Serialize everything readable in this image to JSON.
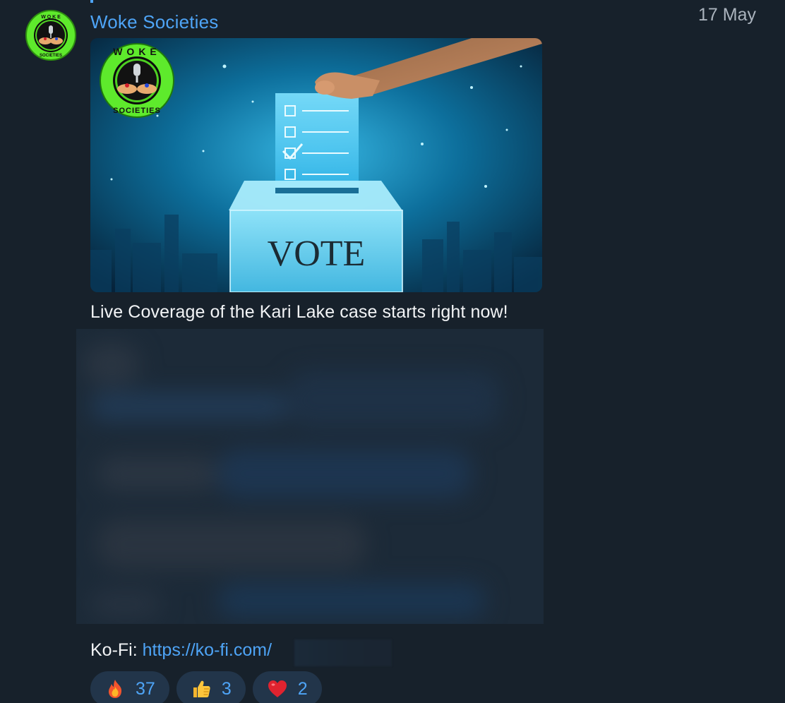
{
  "message": {
    "sender_name": "Woke Societies",
    "date": "17 May",
    "image": {
      "badge_top_text": "WOKE",
      "badge_bottom_text": "SOCIETIES",
      "ballot_box_label": "VOTE"
    },
    "caption": "Live Coverage of the Kari Lake case starts right now!",
    "kofi_label": "Ko-Fi:",
    "kofi_link_visible": "https://ko-fi.com/"
  },
  "reactions": [
    {
      "emoji": "fire-icon",
      "count": "37"
    },
    {
      "emoji": "thumbs-up-icon",
      "count": "3"
    },
    {
      "emoji": "heart-icon",
      "count": "2"
    }
  ],
  "colors": {
    "background": "#17212b",
    "accent": "#4ea4f6",
    "reaction_bg": "#22354a",
    "badge_green": "#5eea2c"
  }
}
